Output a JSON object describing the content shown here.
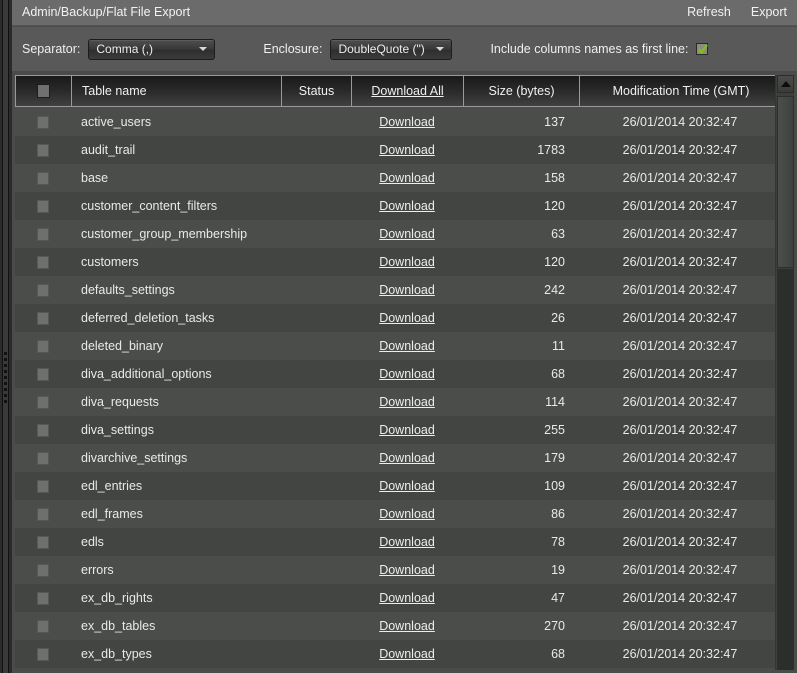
{
  "window": {
    "title": "Admin/Backup/Flat File Export",
    "actions": [
      {
        "name": "refresh",
        "label": "Refresh"
      },
      {
        "name": "export",
        "label": "Export"
      }
    ]
  },
  "toolbar": {
    "separator_label": "Separator:",
    "separator_value": "Comma (,)",
    "enclosure_label": "Enclosure:",
    "enclosure_value": "DoubleQuote (\")",
    "include_columns_label": "Include columns names as first line:",
    "include_columns_checked": true,
    "checkbox_color": "#8e8e78",
    "check_color": "#7cc024"
  },
  "table": {
    "columns": [
      {
        "key": "check",
        "label": ""
      },
      {
        "key": "name",
        "label": "Table name"
      },
      {
        "key": "status",
        "label": "Status"
      },
      {
        "key": "download",
        "label": "Download All",
        "link": true
      },
      {
        "key": "size",
        "label": "Size (bytes)"
      },
      {
        "key": "modified",
        "label": "Modification Time (GMT)"
      }
    ],
    "download_cell_label": "Download",
    "rows": [
      {
        "name": "active_users",
        "status": "",
        "download": "Download",
        "size": "137",
        "modified": "26/01/2014 20:32:47"
      },
      {
        "name": "audit_trail",
        "status": "",
        "download": "Download",
        "size": "1783",
        "modified": "26/01/2014 20:32:47"
      },
      {
        "name": "base",
        "status": "",
        "download": "Download",
        "size": "158",
        "modified": "26/01/2014 20:32:47"
      },
      {
        "name": "customer_content_filters",
        "status": "",
        "download": "Download",
        "size": "120",
        "modified": "26/01/2014 20:32:47"
      },
      {
        "name": "customer_group_membership",
        "status": "",
        "download": "Download",
        "size": "63",
        "modified": "26/01/2014 20:32:47"
      },
      {
        "name": "customers",
        "status": "",
        "download": "Download",
        "size": "120",
        "modified": "26/01/2014 20:32:47"
      },
      {
        "name": "defaults_settings",
        "status": "",
        "download": "Download",
        "size": "242",
        "modified": "26/01/2014 20:32:47"
      },
      {
        "name": "deferred_deletion_tasks",
        "status": "",
        "download": "Download",
        "size": "26",
        "modified": "26/01/2014 20:32:47"
      },
      {
        "name": "deleted_binary",
        "status": "",
        "download": "Download",
        "size": "11",
        "modified": "26/01/2014 20:32:47"
      },
      {
        "name": "diva_additional_options",
        "status": "",
        "download": "Download",
        "size": "68",
        "modified": "26/01/2014 20:32:47"
      },
      {
        "name": "diva_requests",
        "status": "",
        "download": "Download",
        "size": "114",
        "modified": "26/01/2014 20:32:47"
      },
      {
        "name": "diva_settings",
        "status": "",
        "download": "Download",
        "size": "255",
        "modified": "26/01/2014 20:32:47"
      },
      {
        "name": "divarchive_settings",
        "status": "",
        "download": "Download",
        "size": "179",
        "modified": "26/01/2014 20:32:47"
      },
      {
        "name": "edl_entries",
        "status": "",
        "download": "Download",
        "size": "109",
        "modified": "26/01/2014 20:32:47"
      },
      {
        "name": "edl_frames",
        "status": "",
        "download": "Download",
        "size": "86",
        "modified": "26/01/2014 20:32:47"
      },
      {
        "name": "edls",
        "status": "",
        "download": "Download",
        "size": "78",
        "modified": "26/01/2014 20:32:47"
      },
      {
        "name": "errors",
        "status": "",
        "download": "Download",
        "size": "19",
        "modified": "26/01/2014 20:32:47"
      },
      {
        "name": "ex_db_rights",
        "status": "",
        "download": "Download",
        "size": "47",
        "modified": "26/01/2014 20:32:47"
      },
      {
        "name": "ex_db_tables",
        "status": "",
        "download": "Download",
        "size": "270",
        "modified": "26/01/2014 20:32:47"
      },
      {
        "name": "ex_db_types",
        "status": "",
        "download": "Download",
        "size": "68",
        "modified": "26/01/2014 20:32:47"
      }
    ]
  },
  "scrollbar": {
    "orientation": "vertical",
    "up_arrow_icon": "triangle-up-icon"
  },
  "theme": {
    "window_bg": "#4a4c4a",
    "titlebar_bg": "#6b6b6b",
    "toolbar_bg": "#595959",
    "row_odd": "#4b4d4b",
    "row_even": "#434543",
    "text": "#e9e9e9"
  }
}
